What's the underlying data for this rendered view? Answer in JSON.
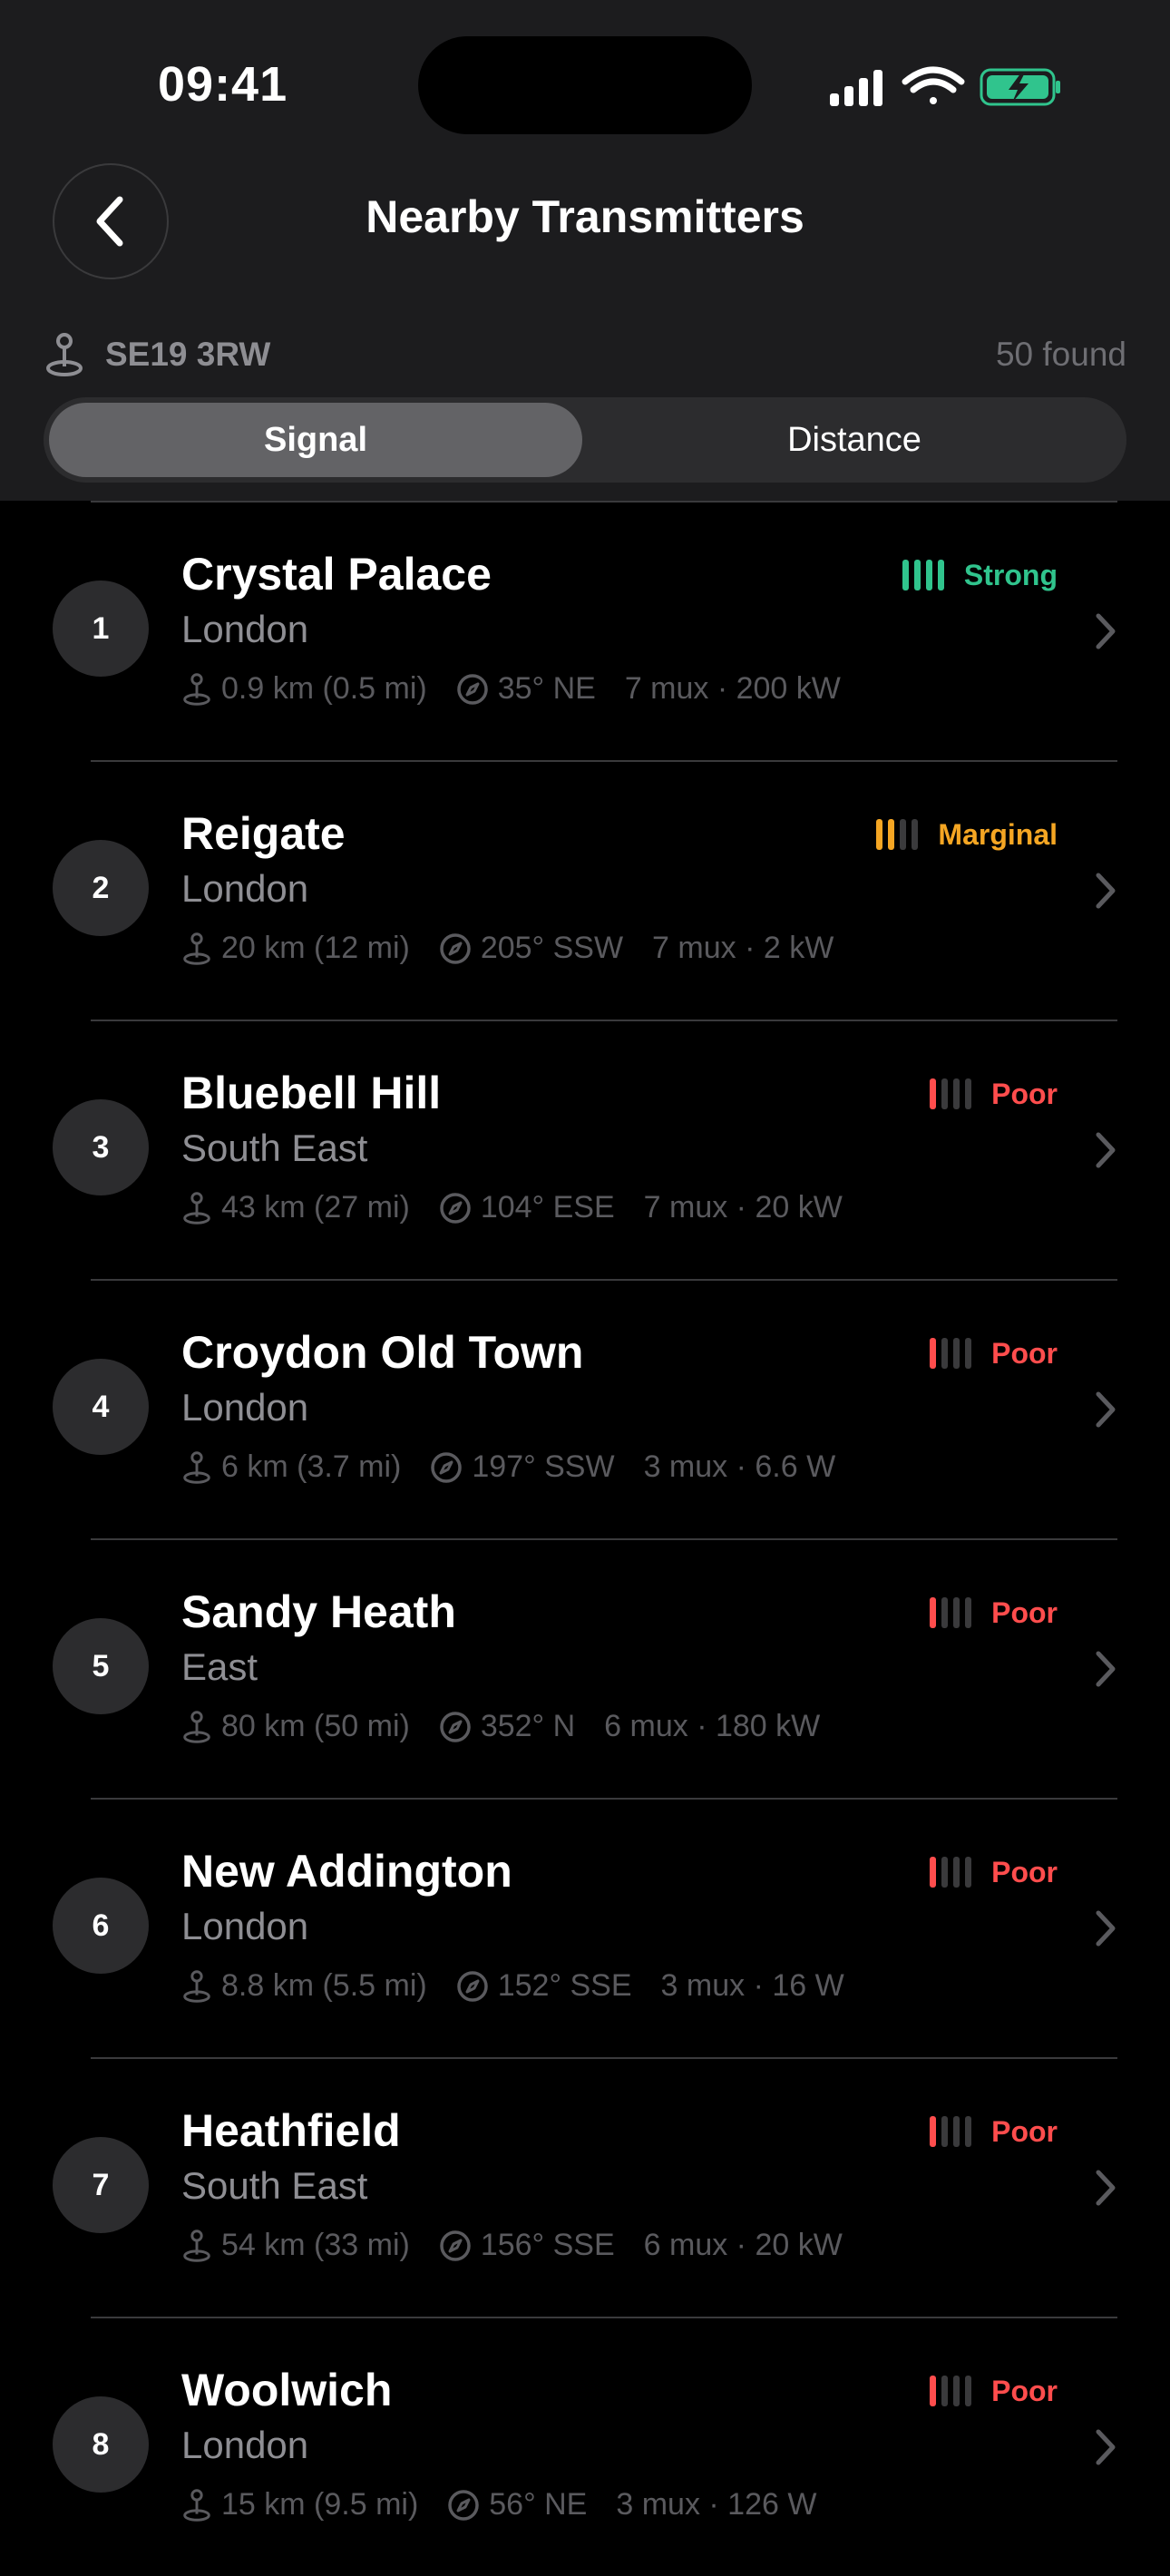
{
  "status_bar": {
    "time": "09:41"
  },
  "nav": {
    "title": "Nearby Transmitters"
  },
  "location": {
    "postcode": "SE19 3RW",
    "count": "50 found"
  },
  "sort": {
    "options": [
      "Signal",
      "Distance"
    ],
    "selected": "Signal"
  },
  "colors": {
    "strong": "#30c48d",
    "marginal": "#f5a623",
    "poor": "#ff4d4d"
  },
  "transmitters": [
    {
      "rank": "1",
      "name": "Crystal Palace",
      "region": "London",
      "distance": "0.9 km (0.5 mi)",
      "bearing": "35° NE",
      "mux_power": "7 mux · 200 kW",
      "signal": "Strong",
      "bars": 4
    },
    {
      "rank": "2",
      "name": "Reigate",
      "region": "London",
      "distance": "20 km (12 mi)",
      "bearing": "205° SSW",
      "mux_power": "7 mux · 2 kW",
      "signal": "Marginal",
      "bars": 2
    },
    {
      "rank": "3",
      "name": "Bluebell Hill",
      "region": "South East",
      "distance": "43 km (27 mi)",
      "bearing": "104° ESE",
      "mux_power": "7 mux · 20 kW",
      "signal": "Poor",
      "bars": 1
    },
    {
      "rank": "4",
      "name": "Croydon Old Town",
      "region": "London",
      "distance": "6 km (3.7 mi)",
      "bearing": "197° SSW",
      "mux_power": "3 mux · 6.6 W",
      "signal": "Poor",
      "bars": 1
    },
    {
      "rank": "5",
      "name": "Sandy Heath",
      "region": "East",
      "distance": "80 km (50 mi)",
      "bearing": "352° N",
      "mux_power": "6 mux · 180 kW",
      "signal": "Poor",
      "bars": 1
    },
    {
      "rank": "6",
      "name": "New Addington",
      "region": "London",
      "distance": "8.8 km (5.5 mi)",
      "bearing": "152° SSE",
      "mux_power": "3 mux · 16 W",
      "signal": "Poor",
      "bars": 1
    },
    {
      "rank": "7",
      "name": "Heathfield",
      "region": "South East",
      "distance": "54 km (33 mi)",
      "bearing": "156° SSE",
      "mux_power": "6 mux · 20 kW",
      "signal": "Poor",
      "bars": 1
    },
    {
      "rank": "8",
      "name": "Woolwich",
      "region": "London",
      "distance": "15 km (9.5 mi)",
      "bearing": "56° NE",
      "mux_power": "3 mux · 126 W",
      "signal": "Poor",
      "bars": 1
    }
  ]
}
